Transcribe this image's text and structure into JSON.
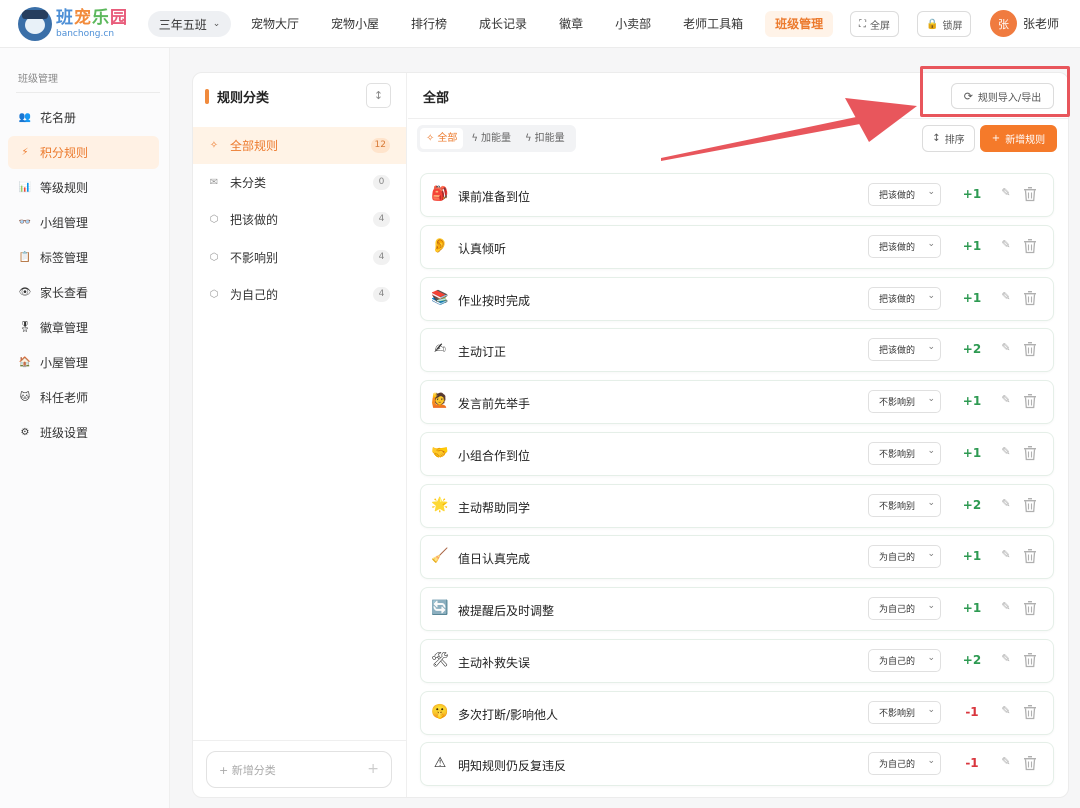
{
  "app": {
    "logo_text_chars": [
      "班",
      "宠",
      "乐",
      "园"
    ],
    "logo_sub": "banchong.cn",
    "class_selector": "三年五班"
  },
  "nav": [
    {
      "label": "宠物大厅",
      "active": false
    },
    {
      "label": "宠物小屋",
      "active": false
    },
    {
      "label": "排行榜",
      "active": false
    },
    {
      "label": "成长记录",
      "active": false
    },
    {
      "label": "徽章",
      "active": false
    },
    {
      "label": "小卖部",
      "active": false
    },
    {
      "label": "老师工具箱",
      "active": false
    },
    {
      "label": "班级管理",
      "active": true
    }
  ],
  "top_actions": {
    "fullscreen": "全屏",
    "lock": "锁屏",
    "avatar_initial": "张",
    "user_name": "张老师"
  },
  "sidebar": {
    "title": "班级管理",
    "items": [
      {
        "label": "花名册",
        "icon": "👥"
      },
      {
        "label": "积分规则",
        "icon": "⚡"
      },
      {
        "label": "等级规则",
        "icon": "📊"
      },
      {
        "label": "小组管理",
        "icon": "👓"
      },
      {
        "label": "标签管理",
        "icon": "📋"
      },
      {
        "label": "家长查看",
        "icon": "👁"
      },
      {
        "label": "徽章管理",
        "icon": "🎖"
      },
      {
        "label": "小屋管理",
        "icon": "🏠"
      },
      {
        "label": "科任老师",
        "icon": "🐱"
      },
      {
        "label": "班级设置",
        "icon": "⚙"
      }
    ],
    "active_index": 1
  },
  "categories": {
    "title": "规则分类",
    "items": [
      {
        "label": "全部规则",
        "count": "12"
      },
      {
        "label": "未分类",
        "count": "0"
      },
      {
        "label": "把该做的",
        "count": "4"
      },
      {
        "label": "不影响别",
        "count": "4"
      },
      {
        "label": "为自己的",
        "count": "4"
      }
    ],
    "active_index": 0,
    "add_label": "+ 新增分类"
  },
  "rules_panel": {
    "title": "全部",
    "import_export": "规则导入/导出",
    "tabs": [
      {
        "label": "全部",
        "active": true
      },
      {
        "label": "加能量",
        "active": false
      },
      {
        "label": "扣能量",
        "active": false
      }
    ],
    "sort_label": "排序",
    "add_rule_label": "新增规则",
    "rules": [
      {
        "icon": "🎒",
        "name": "课前准备到位",
        "category": "把该做的",
        "score": "+1"
      },
      {
        "icon": "👂",
        "name": "认真倾听",
        "category": "把该做的",
        "score": "+1"
      },
      {
        "icon": "📚",
        "name": "作业按时完成",
        "category": "把该做的",
        "score": "+1"
      },
      {
        "icon": "✍",
        "name": "主动订正",
        "category": "把该做的",
        "score": "+2"
      },
      {
        "icon": "🙋",
        "name": "发言前先举手",
        "category": "不影响别",
        "score": "+1"
      },
      {
        "icon": "🤝",
        "name": "小组合作到位",
        "category": "不影响别",
        "score": "+1"
      },
      {
        "icon": "🌟",
        "name": "主动帮助同学",
        "category": "不影响别",
        "score": "+2"
      },
      {
        "icon": "🧹",
        "name": "值日认真完成",
        "category": "为自己的",
        "score": "+1"
      },
      {
        "icon": "🔄",
        "name": "被提醒后及时调整",
        "category": "为自己的",
        "score": "+1"
      },
      {
        "icon": "🛠",
        "name": "主动补救失误",
        "category": "为自己的",
        "score": "+2"
      },
      {
        "icon": "🤫",
        "name": "多次打断/影响他人",
        "category": "不影响别",
        "score": "-1"
      },
      {
        "icon": "⚠",
        "name": "明知规则仍反复违反",
        "category": "为自己的",
        "score": "-1"
      }
    ]
  },
  "colors": {
    "accent": "#f57a2a",
    "positive": "#2e9a52",
    "negative": "#d9363e",
    "annotation": "#e8565c"
  }
}
